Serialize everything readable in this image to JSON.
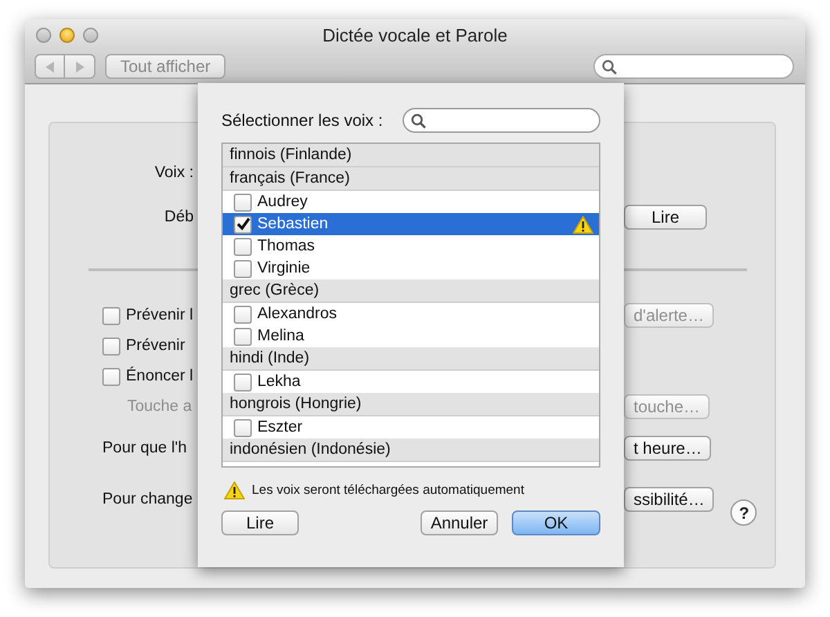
{
  "window": {
    "title": "Dictée vocale et Parole"
  },
  "toolbar": {
    "show_all": "Tout afficher"
  },
  "background": {
    "rows": [
      {
        "kind": "label",
        "text": "Voix :"
      },
      {
        "kind": "label",
        "text": "Déb",
        "button": "Lire",
        "button_disabled": false
      },
      {
        "kind": "divider"
      },
      {
        "kind": "checkbox",
        "text": "Prévenir l",
        "checked": false,
        "button": "d'alerte…",
        "button_disabled": true
      },
      {
        "kind": "checkbox",
        "text": "Prévenir",
        "checked": false
      },
      {
        "kind": "checkbox",
        "text": "Énoncer l",
        "checked": false
      },
      {
        "kind": "hint",
        "text": "Touche a",
        "button": "touche…",
        "button_disabled": true
      },
      {
        "kind": "action",
        "text": "Pour que l'h",
        "button": "t heure…",
        "button_disabled": false
      },
      {
        "kind": "action",
        "text": "Pour change",
        "button": "ssibilité…",
        "button_disabled": false,
        "help": "?"
      }
    ]
  },
  "sheet": {
    "title": "Sélectionner les voix :",
    "groups": [
      {
        "name": "finnois (Finlande)"
      },
      {
        "name": "français (France)",
        "items": [
          {
            "name": "Audrey",
            "checked": false,
            "selected": false,
            "warning": false
          },
          {
            "name": "Sebastien",
            "checked": true,
            "selected": true,
            "warning": true
          },
          {
            "name": "Thomas",
            "checked": false,
            "selected": false,
            "warning": false
          },
          {
            "name": "Virginie",
            "checked": false,
            "selected": false,
            "warning": false
          }
        ]
      },
      {
        "name": "grec (Grèce)",
        "items": [
          {
            "name": "Alexandros",
            "checked": false,
            "selected": false,
            "warning": false
          },
          {
            "name": "Melina",
            "checked": false,
            "selected": false,
            "warning": false
          }
        ]
      },
      {
        "name": "hindi (Inde)",
        "items": [
          {
            "name": "Lekha",
            "checked": false,
            "selected": false,
            "warning": false
          }
        ]
      },
      {
        "name": "hongrois (Hongrie)",
        "items": [
          {
            "name": "Eszter",
            "checked": false,
            "selected": false,
            "warning": false
          }
        ]
      },
      {
        "name": "indonésien (Indonésie)"
      }
    ],
    "notice": "Les voix seront téléchargées automatiquement",
    "buttons": [
      {
        "label": "Lire",
        "kind": "normal"
      },
      {
        "label": "Annuler",
        "kind": "normal"
      },
      {
        "label": "OK",
        "kind": "default"
      }
    ]
  }
}
